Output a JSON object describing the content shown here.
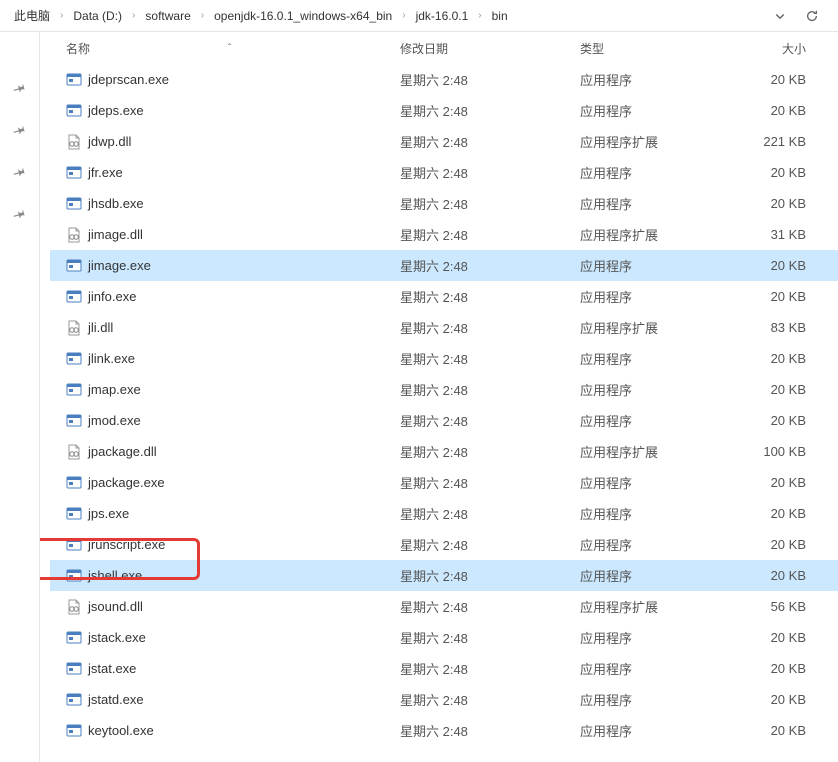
{
  "breadcrumb": [
    "此电脑",
    "Data (D:)",
    "software",
    "openjdk-16.0.1_windows-x64_bin",
    "jdk-16.0.1",
    "bin"
  ],
  "columns": {
    "name": "名称",
    "date": "修改日期",
    "type": "类型",
    "size": "大小"
  },
  "type_app": "应用程序",
  "type_ext": "应用程序扩展",
  "files": [
    {
      "name": "jdeprscan.exe",
      "date": "星期六 2:48",
      "type": "app",
      "size": "20 KB",
      "icon": "exe"
    },
    {
      "name": "jdeps.exe",
      "date": "星期六 2:48",
      "type": "app",
      "size": "20 KB",
      "icon": "exe"
    },
    {
      "name": "jdwp.dll",
      "date": "星期六 2:48",
      "type": "ext",
      "size": "221 KB",
      "icon": "dll"
    },
    {
      "name": "jfr.exe",
      "date": "星期六 2:48",
      "type": "app",
      "size": "20 KB",
      "icon": "exe"
    },
    {
      "name": "jhsdb.exe",
      "date": "星期六 2:48",
      "type": "app",
      "size": "20 KB",
      "icon": "exe"
    },
    {
      "name": "jimage.dll",
      "date": "星期六 2:48",
      "type": "ext",
      "size": "31 KB",
      "icon": "dll"
    },
    {
      "name": "jimage.exe",
      "date": "星期六 2:48",
      "type": "app",
      "size": "20 KB",
      "icon": "exe",
      "highlight": true
    },
    {
      "name": "jinfo.exe",
      "date": "星期六 2:48",
      "type": "app",
      "size": "20 KB",
      "icon": "exe"
    },
    {
      "name": "jli.dll",
      "date": "星期六 2:48",
      "type": "ext",
      "size": "83 KB",
      "icon": "dll"
    },
    {
      "name": "jlink.exe",
      "date": "星期六 2:48",
      "type": "app",
      "size": "20 KB",
      "icon": "exe"
    },
    {
      "name": "jmap.exe",
      "date": "星期六 2:48",
      "type": "app",
      "size": "20 KB",
      "icon": "exe"
    },
    {
      "name": "jmod.exe",
      "date": "星期六 2:48",
      "type": "app",
      "size": "20 KB",
      "icon": "exe"
    },
    {
      "name": "jpackage.dll",
      "date": "星期六 2:48",
      "type": "ext",
      "size": "100 KB",
      "icon": "dll"
    },
    {
      "name": "jpackage.exe",
      "date": "星期六 2:48",
      "type": "app",
      "size": "20 KB",
      "icon": "exe"
    },
    {
      "name": "jps.exe",
      "date": "星期六 2:48",
      "type": "app",
      "size": "20 KB",
      "icon": "exe"
    },
    {
      "name": "jrunscript.exe",
      "date": "星期六 2:48",
      "type": "app",
      "size": "20 KB",
      "icon": "exe"
    },
    {
      "name": "jshell.exe",
      "date": "星期六 2:48",
      "type": "app",
      "size": "20 KB",
      "icon": "exe",
      "highlight": true,
      "redbox": true
    },
    {
      "name": "jsound.dll",
      "date": "星期六 2:48",
      "type": "ext",
      "size": "56 KB",
      "icon": "dll"
    },
    {
      "name": "jstack.exe",
      "date": "星期六 2:48",
      "type": "app",
      "size": "20 KB",
      "icon": "exe"
    },
    {
      "name": "jstat.exe",
      "date": "星期六 2:48",
      "type": "app",
      "size": "20 KB",
      "icon": "exe"
    },
    {
      "name": "jstatd.exe",
      "date": "星期六 2:48",
      "type": "app",
      "size": "20 KB",
      "icon": "exe"
    },
    {
      "name": "keytool.exe",
      "date": "星期六 2:48",
      "type": "app",
      "size": "20 KB",
      "icon": "exe"
    }
  ]
}
